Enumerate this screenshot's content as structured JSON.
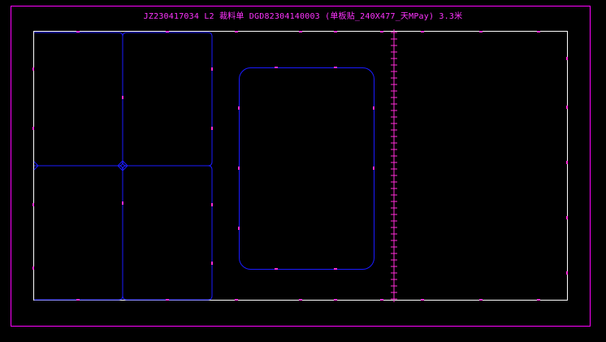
{
  "title": "JZ230417034 L2 裁料单 DGD82304140003 (单板贴_240X477_天MPay) 3.3米",
  "colors": {
    "background": "#000000",
    "outer_frame": "#ff00ff",
    "panel_border": "#ffffff",
    "cut_lines": "#1a1aff",
    "markers": "#ff2bd6",
    "title_text": "#ff33ff"
  },
  "panel": {
    "layout_left": "2x2 grid of rounded rectangles",
    "layout_center": "single rounded rectangle",
    "layout_right": "blank region with tick-marked divider"
  }
}
